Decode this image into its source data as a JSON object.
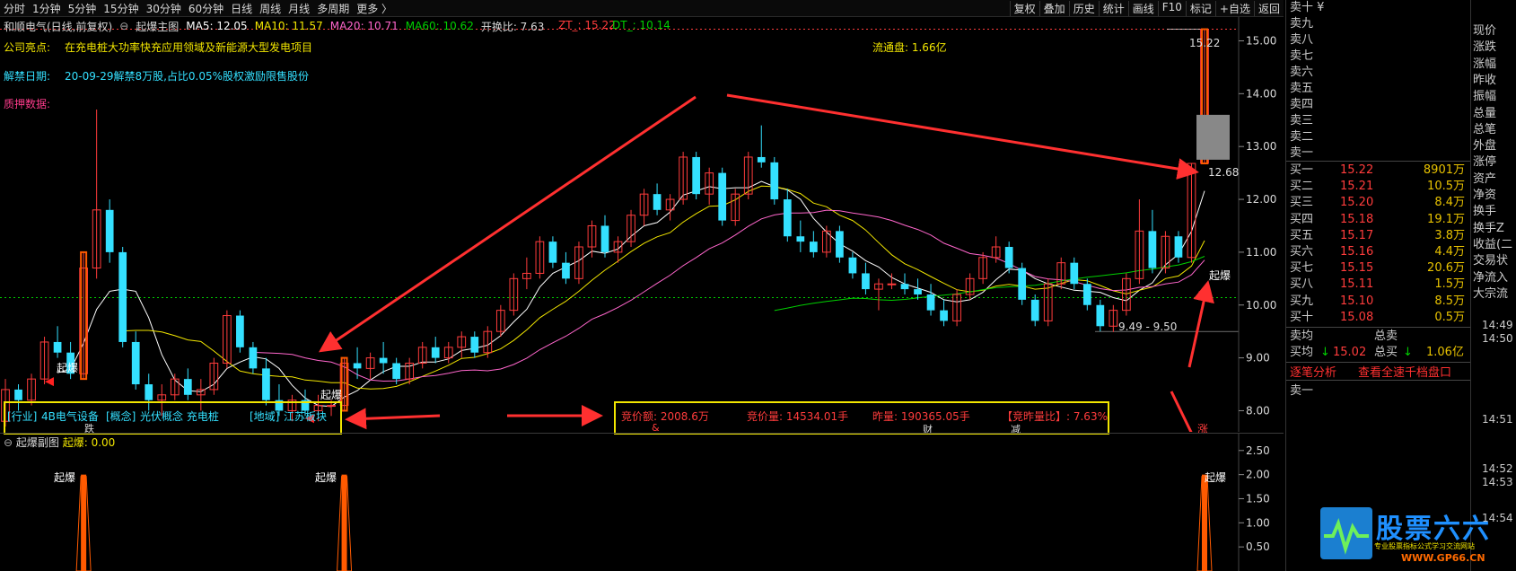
{
  "toolbar": {
    "left": [
      "分时",
      "1分钟",
      "5分钟",
      "15分钟",
      "30分钟",
      "60分钟",
      "日线",
      "周线",
      "月线",
      "多周期",
      "更多 〉"
    ],
    "right": [
      "复权",
      "叠加",
      "历史",
      "统计",
      "画线",
      "F10",
      "标记",
      "+自选",
      "返回"
    ]
  },
  "main_header": {
    "stock": "和顺电气(日线,前复权)",
    "indicator": "起爆主图",
    "ma5": "MA5: 12.05",
    "ma10": "MA10: 11.57",
    "ma20": "MA20: 10.71",
    "ma60": "MA60: 10.62",
    "turnover": "开换比: 7.63",
    "zt": "ZT_: 15.22",
    "dt": "DT_: 10.14"
  },
  "info": {
    "highlight_label": "公司亮点:",
    "highlight_text": "在充电桩大功率快充应用领域及新能源大型发电项目",
    "float_label": "流通盘: 1.66亿",
    "unlock_label": "解禁日期:",
    "unlock_text": "20-09-29解禁8万股,占比0.05%股权激励限售股份",
    "pledge_label": "质押数据:"
  },
  "price_axis": [
    "15.00",
    "14.00",
    "13.00",
    "12.00",
    "11.00",
    "10.00",
    "9.00",
    "8.00"
  ],
  "annotations": {
    "high_label": "15.22",
    "ref_label": "12.68",
    "low_label": "9.49 - 9.50",
    "signal": "起爆"
  },
  "box_left": {
    "industry": "[行业]",
    "industry_val": "4B电气设备",
    "concept": "[概念]",
    "concept_val": "光伏概念 充电桩",
    "region": "[地域]",
    "region_val": "江苏板块",
    "mark": "跌"
  },
  "box_right": {
    "auction_amount": "竞价额: 2008.6万",
    "auction_vol": "竞价量: 14534.01手",
    "yesterday_vol": "昨量: 190365.05手",
    "auction_ratio": "【竞昨量比】: 7.63%",
    "marks": [
      "&",
      "财",
      "减"
    ]
  },
  "zhang_mark": "涨",
  "sub_header": {
    "name": "起爆副图",
    "value": "起爆: 0.00"
  },
  "sub_axis": [
    "2.50",
    "2.00",
    "1.50",
    "1.00",
    "0.50"
  ],
  "sub_signals": [
    "起爆",
    "起爆",
    "起爆"
  ],
  "order_book": {
    "sell_header": "卖十 ¥",
    "sells": [
      "卖九",
      "卖八",
      "卖七",
      "卖六",
      "卖五",
      "卖四",
      "卖三",
      "卖二",
      "卖一"
    ],
    "buys": [
      {
        "label": "买一",
        "price": "15.22",
        "vol": "8901万"
      },
      {
        "label": "买二",
        "price": "15.21",
        "vol": "10.5万"
      },
      {
        "label": "买三",
        "price": "15.20",
        "vol": "8.4万"
      },
      {
        "label": "买四",
        "price": "15.18",
        "vol": "19.1万"
      },
      {
        "label": "买五",
        "price": "15.17",
        "vol": "3.8万"
      },
      {
        "label": "买六",
        "price": "15.16",
        "vol": "4.4万"
      },
      {
        "label": "买七",
        "price": "15.15",
        "vol": "20.6万"
      },
      {
        "label": "买八",
        "price": "15.11",
        "vol": "1.5万"
      },
      {
        "label": "买九",
        "price": "15.10",
        "vol": "8.5万"
      },
      {
        "label": "买十",
        "price": "15.08",
        "vol": "0.5万"
      }
    ],
    "avg_sell_label": "卖均",
    "total_sell_label": "总卖",
    "avg_buy_label": "买均",
    "avg_buy_arrow": "↓",
    "avg_buy_val": "15.02",
    "total_buy_label": "总买",
    "total_buy_arrow": "↓",
    "total_buy_val": "1.06亿",
    "link1": "逐笔分析",
    "link2": "查看全速千档盘口",
    "sell1_bottom": "卖一"
  },
  "fields": [
    "现价",
    "涨跌",
    "涨幅",
    "昨收",
    "振幅",
    "总量",
    "总笔",
    "外盘",
    "涨停",
    "资产",
    "净资",
    "换手",
    "换手Z",
    "收益(二",
    "交易状",
    "净流入",
    "大宗流"
  ],
  "times": [
    "14:49",
    "14:50",
    "14:51",
    "14:52",
    "14:53",
    "14:54"
  ],
  "logo": {
    "title": "股票六六",
    "subtitle": "专业股票指标公式学习交流网站",
    "url": "WWW.GP66.CN"
  },
  "colors": {
    "up": "#ff3c3c",
    "down": "#34e0ff",
    "ma5": "#ffffff",
    "ma10": "#f2e600",
    "ma20": "#ff66cc",
    "ma60": "#00d000",
    "box": "#f2e600",
    "arrow": "#ff3030",
    "signal": "#ff5a00"
  },
  "chart_data": {
    "type": "candlestick",
    "y_range": [
      7.6,
      15.45
    ],
    "candles_ohlc": [
      [
        7.8,
        8.6,
        7.7,
        8.4
      ],
      [
        8.4,
        8.5,
        8.0,
        8.2
      ],
      [
        8.2,
        8.7,
        8.1,
        8.6
      ],
      [
        8.6,
        9.4,
        8.5,
        9.3
      ],
      [
        9.3,
        9.6,
        9.0,
        9.1
      ],
      [
        9.1,
        9.3,
        8.6,
        8.7
      ],
      [
        8.7,
        11.0,
        8.6,
        10.7
      ],
      [
        10.7,
        13.7,
        10.5,
        11.8
      ],
      [
        11.8,
        12.0,
        10.8,
        11.0
      ],
      [
        11.0,
        11.1,
        9.2,
        9.3
      ],
      [
        9.3,
        9.5,
        8.4,
        8.5
      ],
      [
        8.5,
        8.7,
        8.0,
        8.2
      ],
      [
        8.2,
        8.5,
        7.9,
        8.3
      ],
      [
        8.3,
        8.7,
        8.2,
        8.6
      ],
      [
        8.6,
        8.8,
        8.2,
        8.3
      ],
      [
        8.3,
        8.6,
        8.0,
        8.4
      ],
      [
        8.4,
        9.0,
        8.3,
        8.9
      ],
      [
        8.9,
        9.9,
        8.8,
        9.8
      ],
      [
        9.8,
        9.9,
        9.1,
        9.2
      ],
      [
        9.2,
        9.3,
        8.7,
        8.8
      ],
      [
        8.8,
        9.0,
        8.1,
        8.2
      ],
      [
        8.2,
        8.5,
        7.9,
        8.0
      ],
      [
        8.0,
        8.3,
        7.8,
        8.2
      ],
      [
        8.2,
        8.4,
        7.9,
        8.0
      ],
      [
        8.0,
        8.3,
        7.8,
        8.1
      ],
      [
        8.1,
        8.2,
        7.9,
        8.1
      ],
      [
        8.1,
        9.0,
        8.0,
        8.9
      ],
      [
        8.9,
        9.2,
        8.6,
        8.8
      ],
      [
        8.8,
        9.1,
        8.6,
        9.0
      ],
      [
        9.0,
        9.3,
        8.7,
        8.9
      ],
      [
        8.9,
        9.0,
        8.5,
        8.6
      ],
      [
        8.6,
        9.0,
        8.5,
        8.9
      ],
      [
        8.9,
        9.3,
        8.8,
        9.2
      ],
      [
        9.2,
        9.4,
        8.9,
        9.0
      ],
      [
        9.0,
        9.3,
        8.9,
        9.2
      ],
      [
        9.2,
        9.5,
        9.0,
        9.4
      ],
      [
        9.4,
        9.5,
        9.0,
        9.1
      ],
      [
        9.1,
        9.6,
        9.0,
        9.5
      ],
      [
        9.5,
        10.0,
        9.4,
        9.9
      ],
      [
        9.9,
        10.6,
        9.8,
        10.5
      ],
      [
        10.5,
        10.9,
        10.3,
        10.6
      ],
      [
        10.6,
        11.3,
        10.5,
        11.2
      ],
      [
        11.2,
        11.3,
        10.7,
        10.8
      ],
      [
        10.8,
        11.0,
        10.4,
        10.5
      ],
      [
        10.5,
        11.2,
        10.4,
        11.1
      ],
      [
        11.1,
        11.6,
        10.9,
        11.5
      ],
      [
        11.5,
        11.7,
        10.9,
        11.0
      ],
      [
        11.0,
        11.3,
        10.8,
        11.2
      ],
      [
        11.2,
        11.8,
        11.1,
        11.7
      ],
      [
        11.7,
        12.2,
        11.5,
        12.1
      ],
      [
        12.1,
        12.3,
        11.7,
        11.8
      ],
      [
        11.8,
        12.1,
        11.6,
        12.0
      ],
      [
        12.0,
        12.9,
        11.9,
        12.8
      ],
      [
        12.8,
        12.9,
        12.0,
        12.1
      ],
      [
        12.1,
        12.6,
        11.9,
        12.5
      ],
      [
        12.5,
        12.6,
        11.5,
        11.6
      ],
      [
        11.6,
        12.2,
        11.5,
        12.1
      ],
      [
        12.1,
        12.9,
        12.0,
        12.8
      ],
      [
        12.8,
        13.4,
        12.6,
        12.7
      ],
      [
        12.7,
        12.8,
        11.9,
        12.0
      ],
      [
        12.0,
        12.2,
        11.2,
        11.3
      ],
      [
        11.3,
        11.6,
        11.0,
        11.2
      ],
      [
        11.2,
        11.4,
        10.9,
        11.0
      ],
      [
        11.0,
        11.5,
        10.9,
        11.4
      ],
      [
        11.4,
        11.5,
        10.8,
        10.9
      ],
      [
        10.9,
        11.0,
        10.5,
        10.6
      ],
      [
        10.6,
        10.8,
        10.2,
        10.3
      ],
      [
        10.3,
        10.5,
        9.9,
        10.4
      ],
      [
        10.4,
        10.6,
        10.3,
        10.4
      ],
      [
        10.4,
        10.6,
        10.2,
        10.3
      ],
      [
        10.3,
        10.5,
        10.1,
        10.2
      ],
      [
        10.2,
        10.4,
        9.8,
        9.9
      ],
      [
        9.9,
        10.1,
        9.6,
        9.7
      ],
      [
        9.7,
        10.3,
        9.6,
        10.2
      ],
      [
        10.2,
        10.6,
        10.1,
        10.5
      ],
      [
        10.5,
        11.0,
        10.4,
        10.9
      ],
      [
        10.9,
        11.3,
        10.8,
        11.1
      ],
      [
        11.1,
        11.2,
        10.6,
        10.7
      ],
      [
        10.7,
        10.8,
        10.0,
        10.1
      ],
      [
        10.1,
        10.2,
        9.6,
        9.7
      ],
      [
        9.7,
        10.5,
        9.6,
        10.4
      ],
      [
        10.4,
        10.9,
        10.3,
        10.8
      ],
      [
        10.8,
        10.9,
        10.3,
        10.4
      ],
      [
        10.4,
        10.5,
        9.9,
        10.0
      ],
      [
        10.0,
        10.1,
        9.5,
        9.6
      ],
      [
        9.6,
        10.0,
        9.49,
        9.9
      ],
      [
        9.9,
        10.6,
        9.8,
        10.5
      ],
      [
        10.5,
        12.0,
        10.4,
        11.4
      ],
      [
        11.4,
        11.8,
        10.6,
        10.7
      ],
      [
        10.7,
        11.4,
        10.6,
        11.3
      ],
      [
        11.3,
        11.4,
        10.8,
        10.9
      ],
      [
        10.9,
        12.68,
        10.8,
        12.68
      ],
      [
        12.68,
        15.22,
        12.68,
        15.22
      ]
    ],
    "ma_values": {
      "MA5": 12.05,
      "MA10": 11.57,
      "MA20": 10.71,
      "MA60": 10.62
    },
    "sub_signal_value": 2.0
  }
}
